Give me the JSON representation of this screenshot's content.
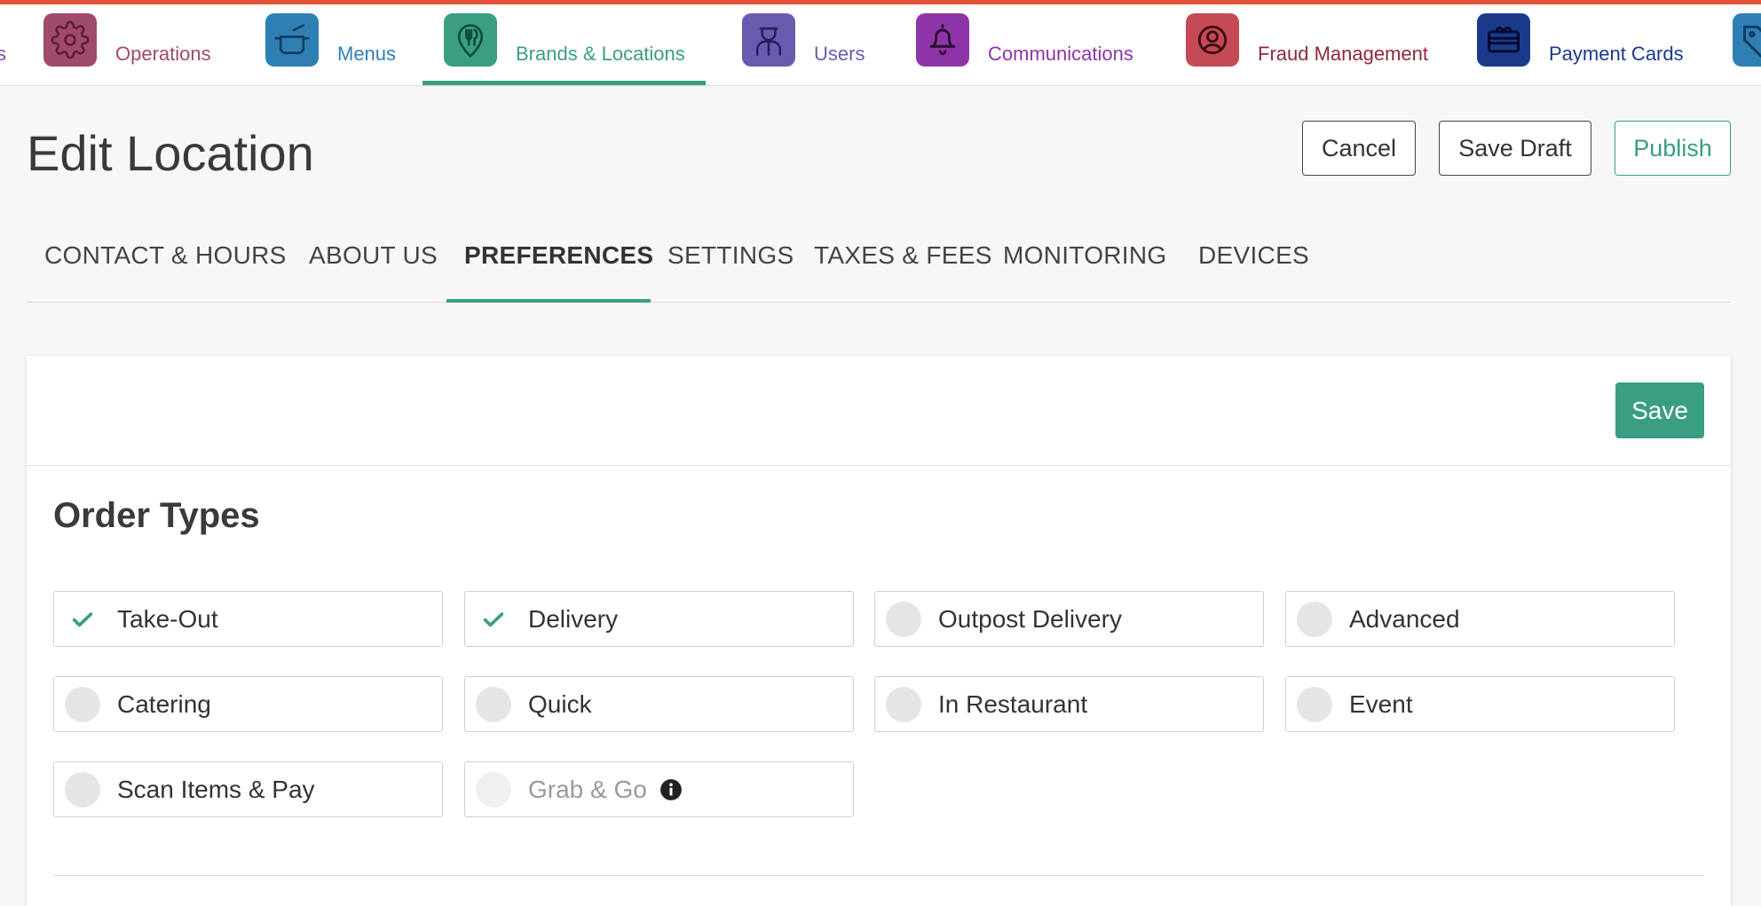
{
  "nav": {
    "accent_bar_color": "#e1543a",
    "active_color": "#3a9e82",
    "items": [
      {
        "label": "s",
        "icon": "tag-icon",
        "color": "#7b4fa6"
      },
      {
        "label": "Operations",
        "icon": "gear-icon",
        "color": "#a04a6c"
      },
      {
        "label": "Menus",
        "icon": "pot-icon",
        "color": "#2f7fb5"
      },
      {
        "label": "Brands & Locations",
        "icon": "map-pin-utensils-icon",
        "color": "#3a9e82",
        "active": true
      },
      {
        "label": "Users",
        "icon": "user-icon",
        "color": "#6a5bb0"
      },
      {
        "label": "Communications",
        "icon": "bell-icon",
        "color": "#8e35a8"
      },
      {
        "label": "Fraud Management",
        "icon": "user-circle-icon",
        "color": "#8f2a3a"
      },
      {
        "label": "Payment Cards",
        "icon": "gift-card-icon",
        "color": "#1c3a8c"
      },
      {
        "label": "",
        "icon": "tag-icon",
        "color": "#2f7fb5"
      }
    ]
  },
  "page": {
    "title": "Edit Location",
    "actions": {
      "cancel": "Cancel",
      "save_draft": "Save Draft",
      "publish": "Publish"
    }
  },
  "tabs": [
    {
      "label": "CONTACT & HOURS"
    },
    {
      "label": "ABOUT US"
    },
    {
      "label": "PREFERENCES",
      "active": true
    },
    {
      "label": "SETTINGS"
    },
    {
      "label": "TAXES & FEES"
    },
    {
      "label": "MONITORING"
    },
    {
      "label": "DEVICES"
    }
  ],
  "card": {
    "save_label": "Save",
    "section_title": "Order Types",
    "order_types": [
      {
        "label": "Take-Out",
        "checked": true
      },
      {
        "label": "Delivery",
        "checked": true
      },
      {
        "label": "Outpost Delivery",
        "checked": false
      },
      {
        "label": "Advanced",
        "checked": false
      },
      {
        "label": "Catering",
        "checked": false
      },
      {
        "label": "Quick",
        "checked": false
      },
      {
        "label": "In Restaurant",
        "checked": false
      },
      {
        "label": "Event",
        "checked": false
      },
      {
        "label": "Scan Items & Pay",
        "checked": false
      },
      {
        "label": "Grab & Go",
        "checked": false,
        "disabled": true,
        "info_icon": "info-icon"
      }
    ]
  }
}
